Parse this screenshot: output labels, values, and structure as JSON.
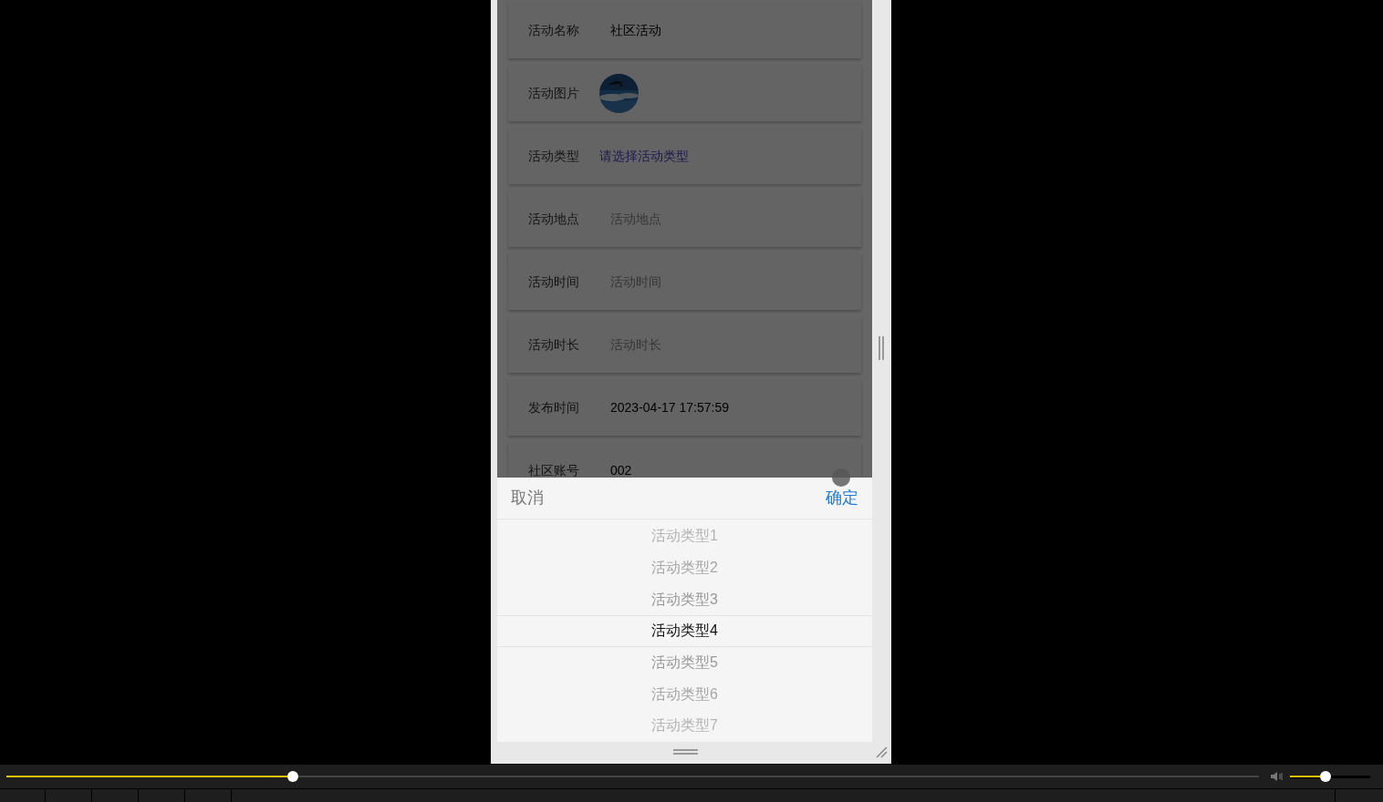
{
  "form": {
    "rows": [
      {
        "kind": "text",
        "label": "活动名称",
        "value": "社区活动"
      },
      {
        "label": "活动图片"
      },
      {
        "kind": "select",
        "label": "活动类型",
        "placeholder": "请选择活动类型"
      },
      {
        "kind": "text",
        "label": "活动地点",
        "placeholder": "活动地点"
      },
      {
        "kind": "text",
        "label": "活动时间",
        "placeholder": "活动时间"
      },
      {
        "kind": "text",
        "label": "活动时长",
        "placeholder": "活动时长"
      },
      {
        "kind": "text",
        "label": "发布时间",
        "value": "2023-04-17 17:57:59"
      },
      {
        "kind": "text",
        "label": "社区账号",
        "value": "002"
      }
    ]
  },
  "picker": {
    "cancel": "取消",
    "confirm": "确定",
    "options": [
      {
        "label": "活动类型1",
        "selected": false
      },
      {
        "label": "活动类型2",
        "selected": false
      },
      {
        "label": "活动类型3",
        "selected": false
      },
      {
        "label": "活动类型4",
        "selected": true
      },
      {
        "label": "活动类型5",
        "selected": false
      },
      {
        "label": "活动类型6",
        "selected": false
      },
      {
        "label": "活动类型7",
        "selected": false
      }
    ]
  },
  "player": {
    "seek": {
      "level": 0.229
    },
    "volume": {
      "level": 0.44
    }
  }
}
